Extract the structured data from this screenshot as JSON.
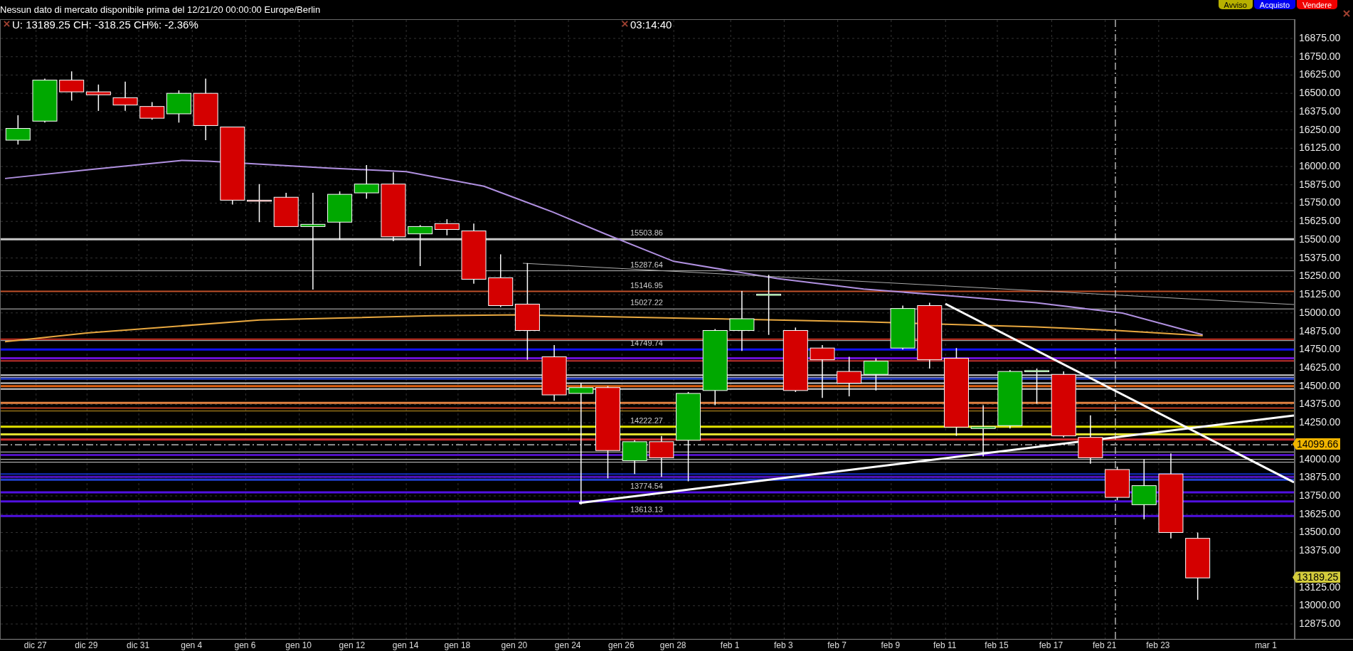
{
  "notice": "Nessun dato di mercato disponibile prima del 12/21/20 00:00:00 Europe/Berlin",
  "order_buttons": [
    {
      "label": "Avviso",
      "kind": "alert"
    },
    {
      "label": "Acquisto",
      "kind": "buy"
    },
    {
      "label": "Vendere",
      "kind": "sell"
    }
  ],
  "chart": {
    "quote": "U: 13189.25 CH: -318.25 CH%: -2.36%",
    "clock": "03:14:40",
    "level_labels": [
      "15503.86",
      "15287.64",
      "15146.95",
      "15027.22",
      "14749.74",
      "14222.27",
      "13774.54",
      "13613.13"
    ],
    "price_ticks": [
      "16875.00",
      "16750.00",
      "16625.00",
      "16500.00",
      "16375.00",
      "16250.00",
      "16125.00",
      "16000.00",
      "15875.00",
      "15750.00",
      "15625.00",
      "15500.00",
      "15375.00",
      "15250.00",
      "15125.00",
      "15000.00",
      "14875.00",
      "14750.00",
      "14625.00",
      "14500.00",
      "14375.00",
      "14250.00",
      "14000.00",
      "13875.00",
      "13750.00",
      "13625.00",
      "13500.00",
      "13375.00",
      "13125.00",
      "13000.00",
      "12875.00"
    ],
    "price_badges": [
      {
        "text": "14099.66",
        "color": "#f0b400"
      },
      {
        "text": "13189.25",
        "color": "#d4cc3c"
      }
    ],
    "dates": [
      "dic 27",
      "dic 29",
      "dic 31",
      "gen 4",
      "gen 6",
      "gen 10",
      "gen 12",
      "gen 14",
      "gen 18",
      "gen 20",
      "gen 24",
      "gen 26",
      "gen 28",
      "feb 1",
      "feb 3",
      "feb 7",
      "feb 9",
      "feb 11",
      "feb 15",
      "feb 17",
      "feb 21",
      "feb 23",
      "mar 1"
    ]
  }
}
